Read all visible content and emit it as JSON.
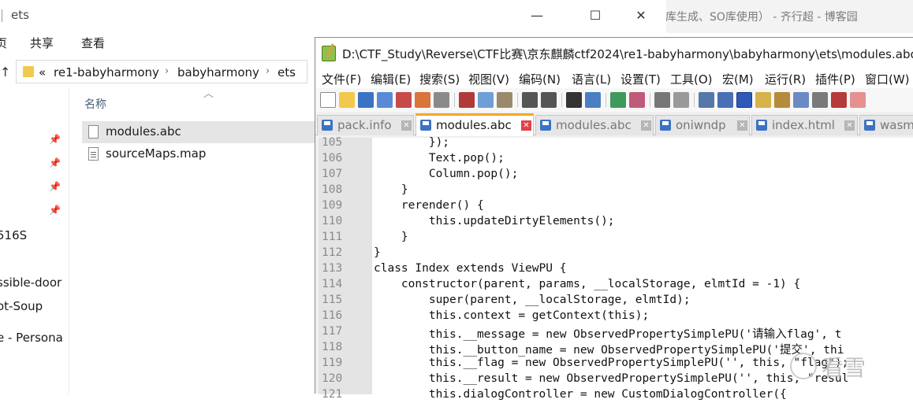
{
  "background_window": {
    "title_fragment": "库生成、SO库使用） - 齐行超 - 博客园"
  },
  "explorer": {
    "title": "ets",
    "window_buttons": {
      "minimize": "—",
      "maximize": "☐",
      "close": "✕"
    },
    "ribbon": [
      "页",
      "共享",
      "查看"
    ],
    "address": {
      "overflow": "«",
      "crumbs": [
        "re1-babyharmony",
        "babyharmony",
        "ets"
      ]
    },
    "nav_items": [
      "516S",
      "ssible-door",
      "ot-Soup",
      "e - Persona"
    ],
    "column_header": "名称",
    "files": [
      {
        "name": "modules.abc",
        "icon": "file-icon",
        "selected": true
      },
      {
        "name": "sourceMaps.map",
        "icon": "text-file-icon",
        "selected": false
      }
    ]
  },
  "notepad": {
    "title": "D:\\CTF_Study\\Reverse\\CTF比赛\\京东麒麟ctf2024\\re1-babyharmony\\babyharmony\\ets\\modules.abc -",
    "menu": [
      "文件(F)",
      "编辑(E)",
      "搜索(S)",
      "视图(V)",
      "编码(N)",
      "语言(L)",
      "设置(T)",
      "工具(O)",
      "宏(M)",
      "运行(R)",
      "插件(P)",
      "窗口(W)"
    ],
    "tabs": [
      {
        "label": "pack.info",
        "active": false
      },
      {
        "label": "modules.abc",
        "active": true
      },
      {
        "label": "modules.abc",
        "active": false
      },
      {
        "label": "oniwndp",
        "active": false
      },
      {
        "label": "index.html",
        "active": false
      },
      {
        "label": "wasm",
        "active": false
      }
    ],
    "lines": [
      {
        "n": "105",
        "text": "        });"
      },
      {
        "n": "106",
        "text": "        Text.pop();"
      },
      {
        "n": "107",
        "text": "        Column.pop();"
      },
      {
        "n": "108",
        "text": "    }"
      },
      {
        "n": "109",
        "text": "    rerender() {"
      },
      {
        "n": "110",
        "text": "        this.updateDirtyElements();"
      },
      {
        "n": "111",
        "text": "    }"
      },
      {
        "n": "112",
        "text": "}"
      },
      {
        "n": "113",
        "text": "class Index extends ViewPU {"
      },
      {
        "n": "114",
        "text": "    constructor(parent, params, __localStorage, elmtId = -1) {"
      },
      {
        "n": "115",
        "text": "        super(parent, __localStorage, elmtId);"
      },
      {
        "n": "116",
        "text": "        this.context = getContext(this);"
      },
      {
        "n": "117",
        "text": "        this.__message = new ObservedPropertySimplePU('请输入flag', t"
      },
      {
        "n": "118",
        "text": "        this.__button_name = new ObservedPropertySimplePU('提交', thi"
      },
      {
        "n": "119",
        "text": "        this.__flag = new ObservedPropertySimplePU('', this, \"flag\");"
      },
      {
        "n": "120",
        "text": "        this.__result = new ObservedPropertySimplePU('', this, \"resul"
      },
      {
        "n": "121",
        "text": "        this.dialogController = new CustomDialogController({"
      }
    ]
  },
  "watermark": {
    "text": "看雪"
  }
}
